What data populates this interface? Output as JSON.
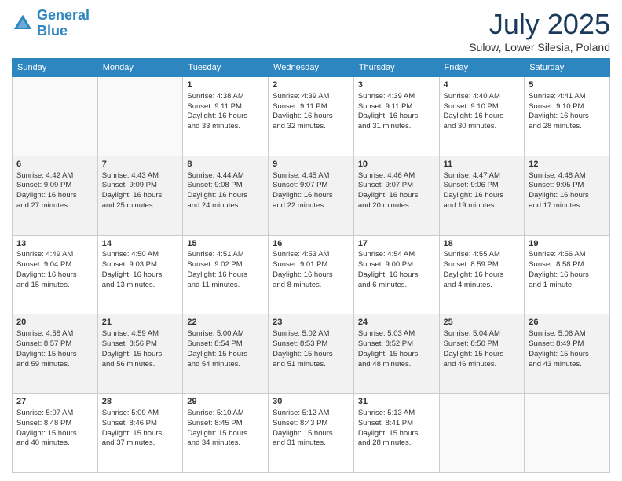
{
  "logo": {
    "line1": "General",
    "line2": "Blue"
  },
  "title": "July 2025",
  "subtitle": "Sulow, Lower Silesia, Poland",
  "days": [
    "Sunday",
    "Monday",
    "Tuesday",
    "Wednesday",
    "Thursday",
    "Friday",
    "Saturday"
  ],
  "weeks": [
    [
      {
        "day": "",
        "content": ""
      },
      {
        "day": "",
        "content": ""
      },
      {
        "day": "1",
        "content": "Sunrise: 4:38 AM\nSunset: 9:11 PM\nDaylight: 16 hours\nand 33 minutes."
      },
      {
        "day": "2",
        "content": "Sunrise: 4:39 AM\nSunset: 9:11 PM\nDaylight: 16 hours\nand 32 minutes."
      },
      {
        "day": "3",
        "content": "Sunrise: 4:39 AM\nSunset: 9:11 PM\nDaylight: 16 hours\nand 31 minutes."
      },
      {
        "day": "4",
        "content": "Sunrise: 4:40 AM\nSunset: 9:10 PM\nDaylight: 16 hours\nand 30 minutes."
      },
      {
        "day": "5",
        "content": "Sunrise: 4:41 AM\nSunset: 9:10 PM\nDaylight: 16 hours\nand 28 minutes."
      }
    ],
    [
      {
        "day": "6",
        "content": "Sunrise: 4:42 AM\nSunset: 9:09 PM\nDaylight: 16 hours\nand 27 minutes."
      },
      {
        "day": "7",
        "content": "Sunrise: 4:43 AM\nSunset: 9:09 PM\nDaylight: 16 hours\nand 25 minutes."
      },
      {
        "day": "8",
        "content": "Sunrise: 4:44 AM\nSunset: 9:08 PM\nDaylight: 16 hours\nand 24 minutes."
      },
      {
        "day": "9",
        "content": "Sunrise: 4:45 AM\nSunset: 9:07 PM\nDaylight: 16 hours\nand 22 minutes."
      },
      {
        "day": "10",
        "content": "Sunrise: 4:46 AM\nSunset: 9:07 PM\nDaylight: 16 hours\nand 20 minutes."
      },
      {
        "day": "11",
        "content": "Sunrise: 4:47 AM\nSunset: 9:06 PM\nDaylight: 16 hours\nand 19 minutes."
      },
      {
        "day": "12",
        "content": "Sunrise: 4:48 AM\nSunset: 9:05 PM\nDaylight: 16 hours\nand 17 minutes."
      }
    ],
    [
      {
        "day": "13",
        "content": "Sunrise: 4:49 AM\nSunset: 9:04 PM\nDaylight: 16 hours\nand 15 minutes."
      },
      {
        "day": "14",
        "content": "Sunrise: 4:50 AM\nSunset: 9:03 PM\nDaylight: 16 hours\nand 13 minutes."
      },
      {
        "day": "15",
        "content": "Sunrise: 4:51 AM\nSunset: 9:02 PM\nDaylight: 16 hours\nand 11 minutes."
      },
      {
        "day": "16",
        "content": "Sunrise: 4:53 AM\nSunset: 9:01 PM\nDaylight: 16 hours\nand 8 minutes."
      },
      {
        "day": "17",
        "content": "Sunrise: 4:54 AM\nSunset: 9:00 PM\nDaylight: 16 hours\nand 6 minutes."
      },
      {
        "day": "18",
        "content": "Sunrise: 4:55 AM\nSunset: 8:59 PM\nDaylight: 16 hours\nand 4 minutes."
      },
      {
        "day": "19",
        "content": "Sunrise: 4:56 AM\nSunset: 8:58 PM\nDaylight: 16 hours\nand 1 minute."
      }
    ],
    [
      {
        "day": "20",
        "content": "Sunrise: 4:58 AM\nSunset: 8:57 PM\nDaylight: 15 hours\nand 59 minutes."
      },
      {
        "day": "21",
        "content": "Sunrise: 4:59 AM\nSunset: 8:56 PM\nDaylight: 15 hours\nand 56 minutes."
      },
      {
        "day": "22",
        "content": "Sunrise: 5:00 AM\nSunset: 8:54 PM\nDaylight: 15 hours\nand 54 minutes."
      },
      {
        "day": "23",
        "content": "Sunrise: 5:02 AM\nSunset: 8:53 PM\nDaylight: 15 hours\nand 51 minutes."
      },
      {
        "day": "24",
        "content": "Sunrise: 5:03 AM\nSunset: 8:52 PM\nDaylight: 15 hours\nand 48 minutes."
      },
      {
        "day": "25",
        "content": "Sunrise: 5:04 AM\nSunset: 8:50 PM\nDaylight: 15 hours\nand 46 minutes."
      },
      {
        "day": "26",
        "content": "Sunrise: 5:06 AM\nSunset: 8:49 PM\nDaylight: 15 hours\nand 43 minutes."
      }
    ],
    [
      {
        "day": "27",
        "content": "Sunrise: 5:07 AM\nSunset: 8:48 PM\nDaylight: 15 hours\nand 40 minutes."
      },
      {
        "day": "28",
        "content": "Sunrise: 5:09 AM\nSunset: 8:46 PM\nDaylight: 15 hours\nand 37 minutes."
      },
      {
        "day": "29",
        "content": "Sunrise: 5:10 AM\nSunset: 8:45 PM\nDaylight: 15 hours\nand 34 minutes."
      },
      {
        "day": "30",
        "content": "Sunrise: 5:12 AM\nSunset: 8:43 PM\nDaylight: 15 hours\nand 31 minutes."
      },
      {
        "day": "31",
        "content": "Sunrise: 5:13 AM\nSunset: 8:41 PM\nDaylight: 15 hours\nand 28 minutes."
      },
      {
        "day": "",
        "content": ""
      },
      {
        "day": "",
        "content": ""
      }
    ]
  ]
}
